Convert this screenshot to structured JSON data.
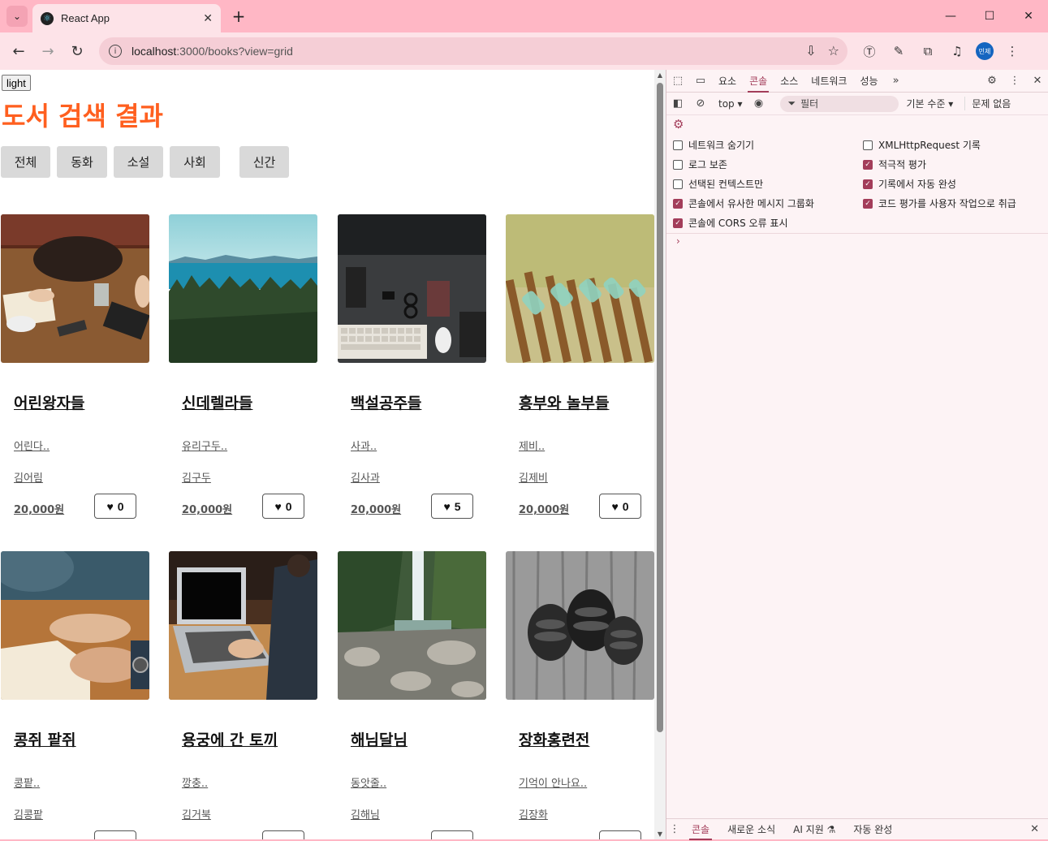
{
  "browser": {
    "tab_title": "React App",
    "url_host": "localhost",
    "url_rest": ":3000/books?view=grid"
  },
  "page": {
    "theme_button": "light",
    "title": "도서 검색 결과",
    "title_color": "#ff5f1f",
    "filters": [
      "전체",
      "동화",
      "소설",
      "사회",
      "신간"
    ]
  },
  "books": [
    {
      "title": "어린왕자들",
      "desc": "어린다..",
      "author": "김어림",
      "price": "20,000원",
      "likes": "0",
      "image": "cafe-table-photo"
    },
    {
      "title": "신데렐라들",
      "desc": "유리구두..",
      "author": "김구두",
      "price": "20,000원",
      "likes": "0",
      "image": "lake-forest-photo"
    },
    {
      "title": "백설공주들",
      "desc": "사과..",
      "author": "김사과",
      "price": "20,000원",
      "likes": "5",
      "image": "desk-keyboard-photo"
    },
    {
      "title": "흥부와 놀부들",
      "desc": "제비..",
      "author": "김제비",
      "price": "20,000원",
      "likes": "0",
      "image": "fence-bottles-photo"
    },
    {
      "title": "콩쥐 팥쥐",
      "desc": "콩팥..",
      "author": "김콩팥",
      "price": "",
      "likes": "",
      "image": "writing-notebook-photo"
    },
    {
      "title": "용궁에 간 토끼",
      "desc": "깡충..",
      "author": "김거북",
      "price": "",
      "likes": "",
      "image": "laptop-typing-photo"
    },
    {
      "title": "해님달님",
      "desc": "동앗줄..",
      "author": "김해님",
      "price": "",
      "likes": "",
      "image": "waterfall-rocks-photo"
    },
    {
      "title": "장화홍련전",
      "desc": "기억이 안나요..",
      "author": "김장화",
      "price": "",
      "likes": "",
      "image": "pinecones-bw-photo"
    }
  ],
  "devtools": {
    "tabs": [
      "요소",
      "콘솔",
      "소스",
      "네트워크",
      "성능"
    ],
    "active_tab": "콘솔",
    "context": "top ▾",
    "filter_placeholder": "필터",
    "level": "기본 수준 ▾",
    "issues": "문제 없음",
    "settings_left": [
      {
        "label": "네트워크 숨기기",
        "checked": false
      },
      {
        "label": "로그 보존",
        "checked": false
      },
      {
        "label": "선택된 컨텍스트만",
        "checked": false
      },
      {
        "label": "콘솔에서 유사한 메시지 그룹화",
        "checked": true
      },
      {
        "label": "콘솔에 CORS 오류 표시",
        "checked": true
      }
    ],
    "settings_right": [
      {
        "label": "XMLHttpRequest 기록",
        "checked": false
      },
      {
        "label": "적극적 평가",
        "checked": true
      },
      {
        "label": "기록에서 자동 완성",
        "checked": true
      },
      {
        "label": "코드 평가를 사용자 작업으로 취급",
        "checked": true
      }
    ],
    "drawer_tabs": [
      "콘솔",
      "새로운 소식",
      "AI 지원 ⚗",
      "자동 완성"
    ],
    "accent": "#a33d5a"
  }
}
